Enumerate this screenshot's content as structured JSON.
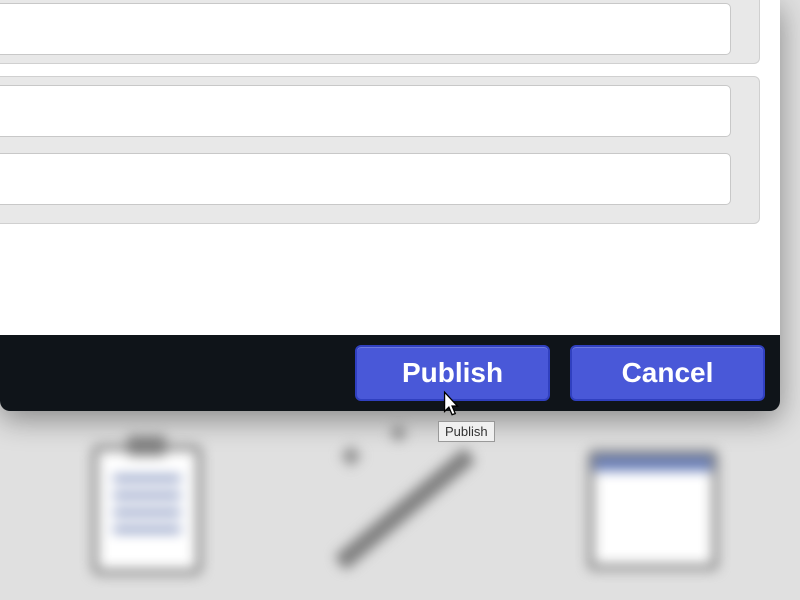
{
  "modal": {
    "fields": {
      "field1": "",
      "field2": "",
      "field3": ""
    },
    "buttons": {
      "publish": "Publish",
      "cancel": "Cancel"
    },
    "tooltip": "Publish"
  },
  "colors": {
    "button_bg": "#4958d8",
    "footer_bg": "#0f1419"
  }
}
